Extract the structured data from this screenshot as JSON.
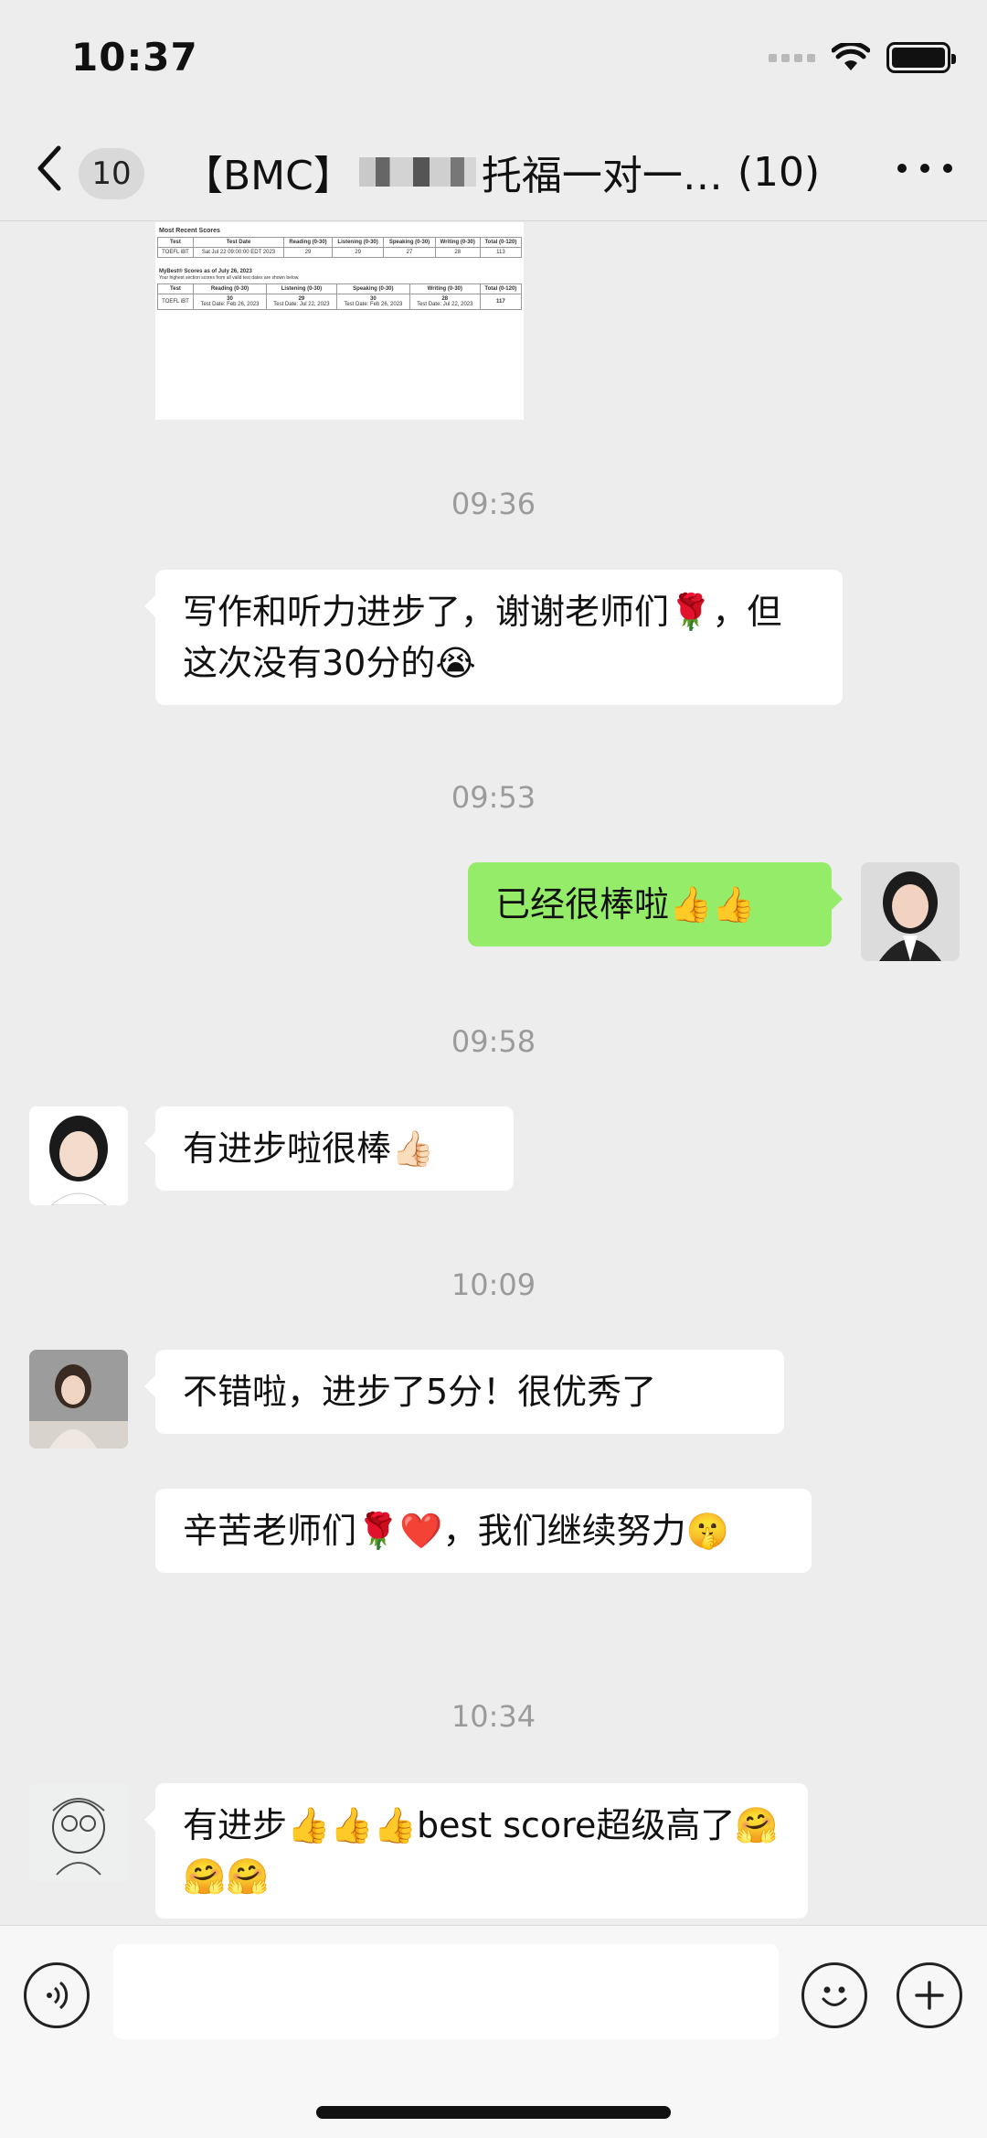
{
  "status_bar": {
    "time": "10:37",
    "icons": [
      "cellular-signal-icon",
      "wifi-icon",
      "battery-icon"
    ]
  },
  "nav": {
    "back_icon": "chevron-left-icon",
    "unread_count": "10",
    "title_prefix": "【BMC】",
    "title_suffix": "托福一对一…",
    "member_count": "(10)",
    "more_icon": "more-dots-icon"
  },
  "score_report": {
    "recent_title": "Most Recent Scores",
    "recent_headers": [
      "Test",
      "Test Date",
      "Reading (0-30)",
      "Listening (0-30)",
      "Speaking (0-30)",
      "Writing (0-30)",
      "Total (0-120)"
    ],
    "recent_row": [
      "TOEFL iBT",
      "Sat Jul 22 09:00:00 EDT 2023",
      "29",
      "29",
      "27",
      "28",
      "113"
    ],
    "mybest_title": "MyBest® Scores as of July 26, 2023",
    "mybest_note": "Your highest section scores from all valid test dates are shown below.",
    "mybest_headers": [
      "Test",
      "Reading (0-30)",
      "Listening (0-30)",
      "Speaking (0-30)",
      "Writing (0-30)",
      "Total (0-120)"
    ],
    "mybest_test": "TOEFL iBT",
    "mybest_cells": [
      {
        "score": "30",
        "date": "Test Date: Feb 26, 2023"
      },
      {
        "score": "29",
        "date": "Test Date: Jul 22, 2023"
      },
      {
        "score": "30",
        "date": "Test Date: Feb 26, 2023"
      },
      {
        "score": "28",
        "date": "Test Date: Jul 22, 2023"
      }
    ],
    "mybest_total": "117"
  },
  "messages": {
    "t1": "09:36",
    "m1": "写作和听力进步了，谢谢老师们🌹，但这次没有30分的😭",
    "t2": "09:53",
    "m2": "已经很棒啦👍👍",
    "t3": "09:58",
    "m3": "有进步啦很棒👍🏻",
    "t4": "10:09",
    "m4": "不错啦，进步了5分！很优秀了",
    "m5": "辛苦老师们🌹❤️，我们继续努力🤫",
    "t5": "10:34",
    "m6": "有进步👍👍👍best score超级高了🤗🤗🤗"
  },
  "input_bar": {
    "voice_icon": "voice-icon",
    "placeholder": "",
    "emoji_icon": "emoji-icon",
    "plus_icon": "plus-icon"
  },
  "colors": {
    "background": "#ededed",
    "sent_bubble": "#95ec69",
    "received_bubble": "#ffffff",
    "timestamp": "#9b9b9b"
  }
}
